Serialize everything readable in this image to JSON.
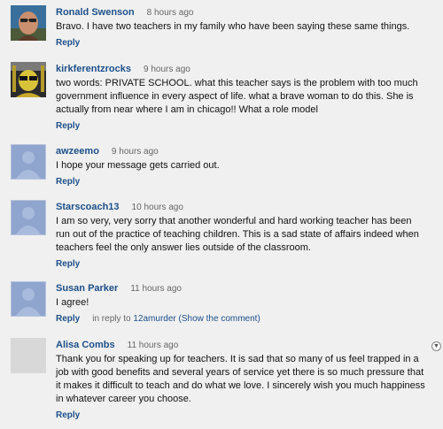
{
  "comments": [
    {
      "author": "Ronald Swenson",
      "time": "8 hours ago",
      "text": "Bravo. I have two teachers in my family who have been saying these same things.",
      "reply": "Reply",
      "avatar": "user-photo"
    },
    {
      "author": "kirkferentzrocks",
      "time": "9 hours ago",
      "text": "two words: PRIVATE SCHOOL. what this teacher says is the problem with too much government influence in every aspect of life. what a brave woman to do this. She is actually from near where I am in chicago!! What a role model",
      "reply": "Reply",
      "avatar": "user-photo"
    },
    {
      "author": "awzeemo",
      "time": "9 hours ago",
      "text": "I hope your message gets carried out.",
      "reply": "Reply",
      "avatar": "default-avatar"
    },
    {
      "author": "Starscoach13",
      "time": "10 hours ago",
      "text": "I am so very, very sorry that another wonderful and hard working teacher has been run out of the practice of teaching children. This is a sad state of affairs indeed when teachers feel the only answer lies outside of the classroom.",
      "reply": "Reply",
      "avatar": "default-avatar"
    },
    {
      "author": "Susan Parker",
      "time": "11 hours ago",
      "text": "I agree!",
      "reply": "Reply",
      "in_reply_prefix": "in reply to",
      "in_reply_user": "12amurder",
      "in_reply_link": "(Show the comment)",
      "avatar": "default-avatar"
    },
    {
      "author": "Alisa Combs",
      "time": "11 hours ago",
      "text": "Thank you for speaking up for teachers. It is sad that so many of us feel trapped in a job with good benefits and several years of service yet there is so much pressure that it makes it difficult to teach and do what we love. I sincerely wish you much happiness in whatever career you choose.",
      "reply": "Reply",
      "avatar": "blank-avatar"
    }
  ],
  "colors": {
    "background": "#f0f0f0",
    "link": "#1c4f8a",
    "meta": "#666666",
    "default_avatar": "#8fa5ce"
  }
}
